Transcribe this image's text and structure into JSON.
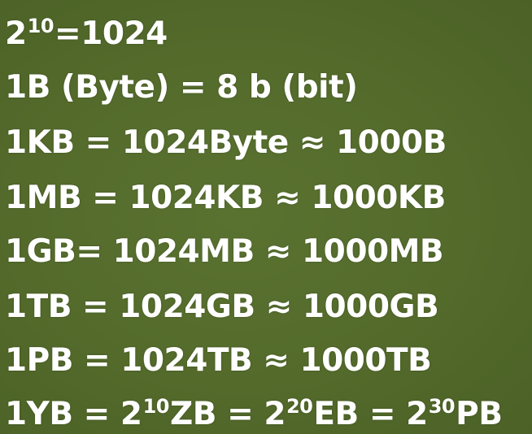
{
  "lines": {
    "l1": {
      "base": "2",
      "exp": "10",
      "rest": "=1024"
    },
    "l2": {
      "text": "1B (Byte) = 8 b (bit)"
    },
    "l3": {
      "text": "1KB = 1024Byte ≈ 1000B"
    },
    "l4": {
      "text": "1MB = 1024KB ≈ 1000KB"
    },
    "l5": {
      "text": "1GB= 1024MB ≈ 1000MB"
    },
    "l6": {
      "text": "1TB = 1024GB ≈ 1000GB"
    },
    "l7": {
      "text": "1PB = 1024TB ≈ 1000TB"
    },
    "l8": {
      "a": "1YB = 2",
      "a_exp": "10",
      "b": "ZB = 2",
      "b_exp": "20",
      "c": "EB = 2",
      "c_exp": "30",
      "d": "PB"
    }
  },
  "colors": {
    "background": "#556b2f",
    "text": "#ffffff"
  }
}
